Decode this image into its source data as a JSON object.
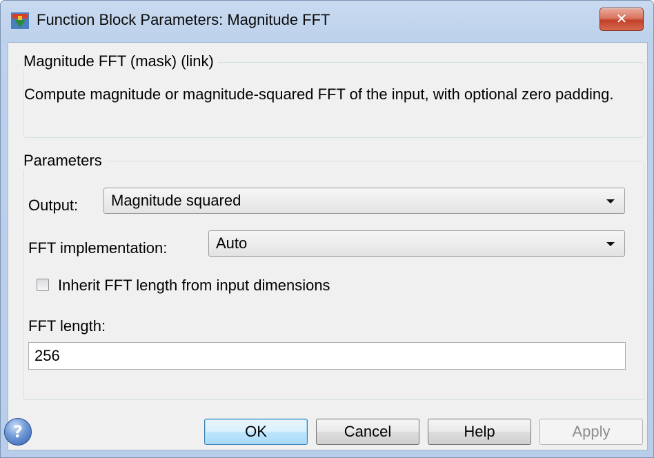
{
  "window": {
    "title": "Function Block Parameters: Magnitude FFT",
    "app_icon": "simulink-block-icon",
    "close_icon": "close-icon",
    "close_glyph": "✕"
  },
  "description_group": {
    "legend": "Magnitude FFT (mask) (link)",
    "text": "Compute magnitude or magnitude-squared FFT of the input, with optional zero padding."
  },
  "parameters_group": {
    "legend": "Parameters",
    "output": {
      "label": "Output:",
      "value": "Magnitude squared"
    },
    "fft_implementation": {
      "label": "FFT implementation:",
      "value": "Auto"
    },
    "inherit_fft_length": {
      "label": "Inherit FFT length from input dimensions",
      "checked": false
    },
    "fft_length": {
      "label": "FFT length:",
      "value": "256"
    }
  },
  "footer": {
    "help_icon": "help-icon",
    "help_glyph": "?",
    "ok": "OK",
    "cancel": "Cancel",
    "help": "Help",
    "apply": "Apply"
  },
  "colors": {
    "title_bar": "#bcd1ec",
    "dialog_bg": "#f0f0f0",
    "close_button": "#c2412a",
    "default_button": "#bee6fd"
  }
}
